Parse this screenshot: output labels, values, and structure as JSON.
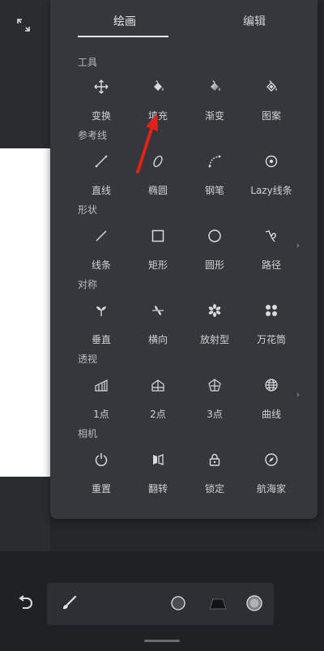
{
  "tabs": {
    "draw": "绘画",
    "edit": "编辑"
  },
  "sections": {
    "tools": {
      "label": "工具",
      "items": [
        {
          "label": "变换",
          "icon": "move-icon"
        },
        {
          "label": "填充",
          "icon": "fill-bucket-icon"
        },
        {
          "label": "渐变",
          "icon": "gradient-icon"
        },
        {
          "label": "图案",
          "icon": "pattern-icon"
        }
      ]
    },
    "guides": {
      "label": "参考线",
      "items": [
        {
          "label": "直线",
          "icon": "line-guide-icon"
        },
        {
          "label": "椭圆",
          "icon": "ellipse-guide-icon"
        },
        {
          "label": "钢笔",
          "icon": "pen-curve-icon"
        },
        {
          "label": "Lazy线条",
          "icon": "lazy-line-icon"
        }
      ]
    },
    "shapes": {
      "label": "形状",
      "items": [
        {
          "label": "线条",
          "icon": "line-shape-icon"
        },
        {
          "label": "矩形",
          "icon": "rectangle-icon"
        },
        {
          "label": "圆形",
          "icon": "circle-icon"
        },
        {
          "label": "路径",
          "icon": "path-icon"
        }
      ]
    },
    "symmetry": {
      "label": "对称",
      "items": [
        {
          "label": "垂直",
          "icon": "vertical-symmetry-icon"
        },
        {
          "label": "横向",
          "icon": "horizontal-symmetry-icon"
        },
        {
          "label": "放射型",
          "icon": "radial-symmetry-icon"
        },
        {
          "label": "万花筒",
          "icon": "kaleidoscope-icon"
        }
      ]
    },
    "perspective": {
      "label": "透视",
      "items": [
        {
          "label": "1点",
          "icon": "one-point-perspective-icon"
        },
        {
          "label": "2点",
          "icon": "two-point-perspective-icon"
        },
        {
          "label": "3点",
          "icon": "three-point-perspective-icon"
        },
        {
          "label": "曲线",
          "icon": "curve-perspective-icon"
        }
      ]
    },
    "camera": {
      "label": "相机",
      "items": [
        {
          "label": "重置",
          "icon": "reset-icon"
        },
        {
          "label": "翻转",
          "icon": "flip-icon"
        },
        {
          "label": "锁定",
          "icon": "lock-icon"
        },
        {
          "label": "航海家",
          "icon": "compass-icon"
        }
      ]
    }
  },
  "colors": {
    "annotation_arrow": "#e0221a",
    "panel": "#34373b"
  }
}
